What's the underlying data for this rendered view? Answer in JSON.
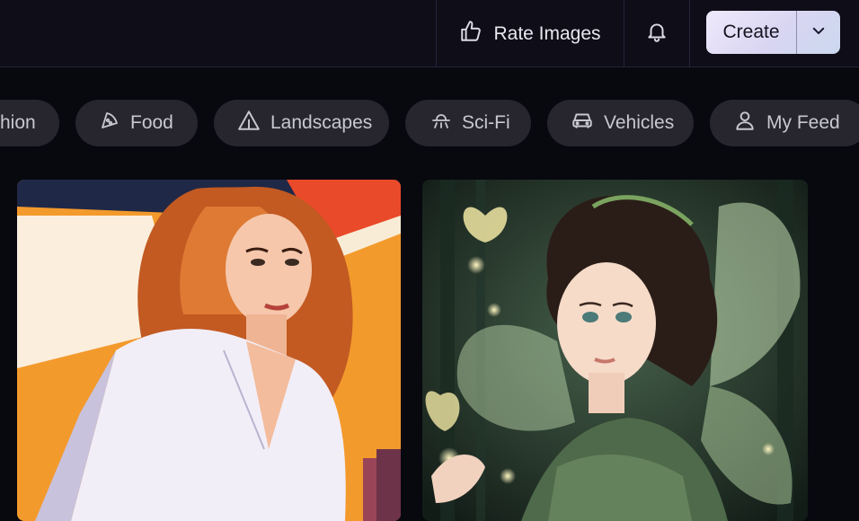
{
  "header": {
    "rate_label": "Rate Images",
    "create_label": "Create"
  },
  "categories": [
    {
      "label": "hion",
      "icon": "fashion-icon"
    },
    {
      "label": "Food",
      "icon": "pizza-icon"
    },
    {
      "label": "Landscapes",
      "icon": "mountain-icon"
    },
    {
      "label": "Sci-Fi",
      "icon": "ufo-icon"
    },
    {
      "label": "Vehicles",
      "icon": "car-icon"
    },
    {
      "label": "My Feed",
      "icon": "user-icon"
    }
  ],
  "gallery": [
    {
      "subject": "illustrated red-haired woman in white shirt",
      "accent": "#f39a2c"
    },
    {
      "subject": "fairy with glowing wings in forest",
      "accent": "#9fc58a"
    }
  ]
}
